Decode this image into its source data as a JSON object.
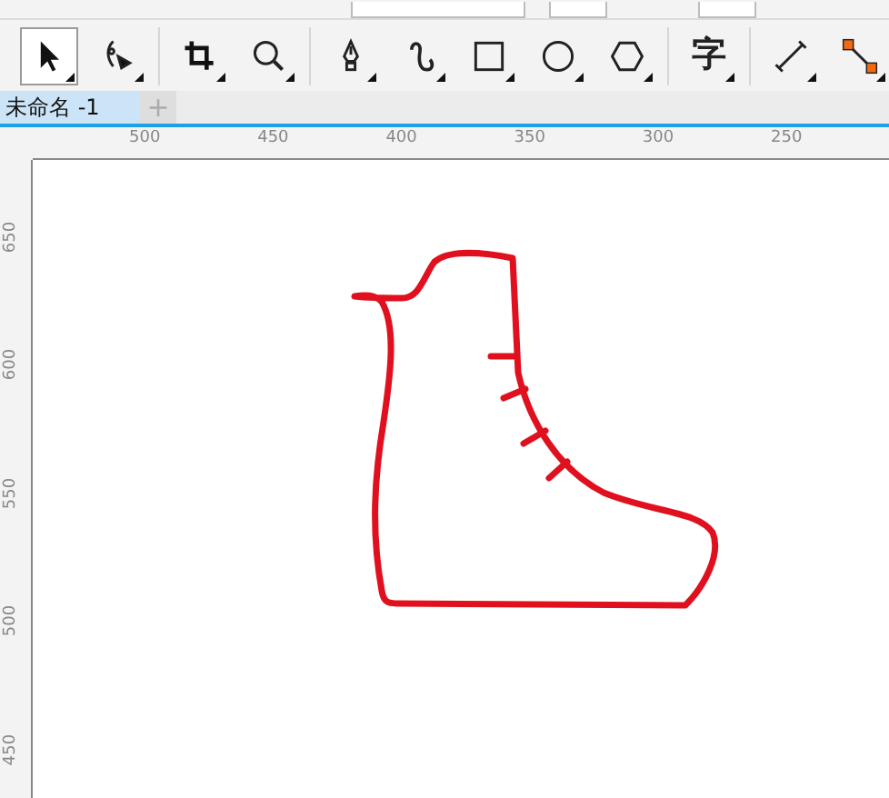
{
  "toolbox": {
    "tools": [
      {
        "kind": "pick",
        "selected": true
      },
      {
        "kind": "shape",
        "selected": false
      },
      {
        "kind": "crop",
        "selected": false
      },
      {
        "kind": "zoom",
        "selected": false
      },
      {
        "kind": "pen",
        "selected": false
      },
      {
        "kind": "freehand",
        "selected": false
      },
      {
        "kind": "rectangle",
        "selected": false
      },
      {
        "kind": "ellipse",
        "selected": false
      },
      {
        "kind": "polygon",
        "selected": false
      },
      {
        "kind": "text",
        "label": "字",
        "selected": false
      },
      {
        "kind": "dimension",
        "selected": false
      },
      {
        "kind": "connector",
        "selected": false
      }
    ]
  },
  "document_tabs": [
    {
      "label": "未命名 -1",
      "selected": true
    },
    {
      "kind": "add",
      "label": "+"
    }
  ],
  "horizontal_ruler": {
    "labels": [
      "500",
      "450",
      "400",
      "350",
      "300",
      "250"
    ]
  },
  "vertical_ruler": {
    "labels": [
      "650",
      "600",
      "550",
      "500",
      "450"
    ]
  },
  "canvas": {
    "shapes": [
      {
        "kind": "boot",
        "color": "#e0101e"
      }
    ]
  }
}
